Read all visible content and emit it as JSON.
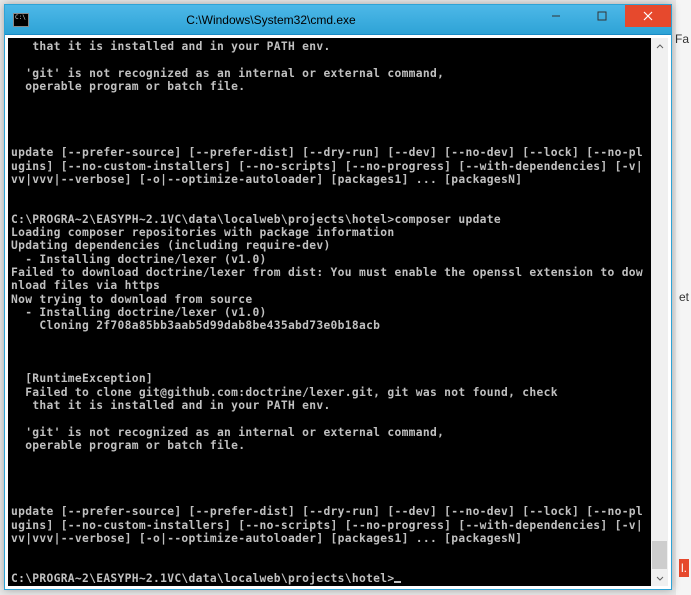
{
  "window": {
    "title": "C:\\Windows\\System32\\cmd.exe"
  },
  "console": {
    "lines": [
      "   that it is installed and in your PATH env.",
      "",
      "  'git' is not recognized as an internal or external command,",
      "  operable program or batch file.",
      "",
      "",
      "",
      "",
      "update [--prefer-source] [--prefer-dist] [--dry-run] [--dev] [--no-dev] [--lock] [--no-plugins] [--no-custom-installers] [--no-scripts] [--no-progress] [--with-dependencies] [-v|vv|vvv|--verbose] [-o|--optimize-autoloader] [packages1] ... [packagesN]",
      "",
      "",
      "C:\\PROGRA~2\\EASYPH~2.1VC\\data\\localweb\\projects\\hotel>composer update",
      "Loading composer repositories with package information",
      "Updating dependencies (including require-dev)",
      "  - Installing doctrine/lexer (v1.0)",
      "Failed to download doctrine/lexer from dist: You must enable the openssl extension to download files via https",
      "Now trying to download from source",
      "  - Installing doctrine/lexer (v1.0)",
      "    Cloning 2f708a85bb3aab5d99dab8be435abd73e0b18acb",
      "",
      "",
      "",
      "  [RuntimeException]",
      "  Failed to clone git@github.com:doctrine/lexer.git, git was not found, check",
      "   that it is installed and in your PATH env.",
      "",
      "  'git' is not recognized as an internal or external command,",
      "  operable program or batch file.",
      "",
      "",
      "",
      "",
      "update [--prefer-source] [--prefer-dist] [--dry-run] [--dev] [--no-dev] [--lock] [--no-plugins] [--no-custom-installers] [--no-scripts] [--no-progress] [--with-dependencies] [-v|vv|vvv|--verbose] [-o|--optimize-autoloader] [packages1] ... [packagesN]",
      "",
      ""
    ],
    "prompt": "C:\\PROGRA~2\\EASYPH~2.1VC\\data\\localweb\\projects\\hotel>"
  },
  "bg": {
    "t1": "Fa",
    "t2": "et",
    "t3": "l."
  }
}
